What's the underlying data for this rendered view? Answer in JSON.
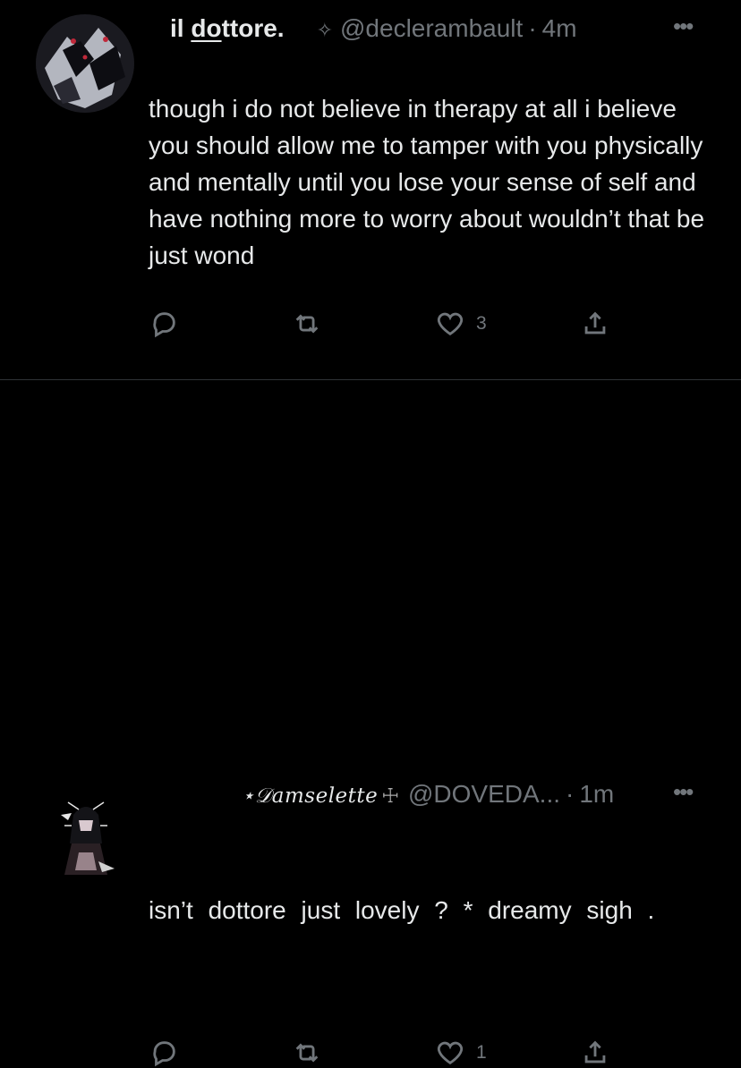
{
  "tweets": [
    {
      "name_pre": "il ",
      "name_underlined": "do",
      "name_post": "ttore.",
      "name_suffix_icon": "✧",
      "handle": "@declerambault",
      "separator": "·",
      "time": "4m",
      "more": "•••",
      "text": "though i do not believe in therapy at all i believe you should allow me to tamper with you physically and mentally until you lose your sense of self and have nothing more to worry about wouldn’t that be just wond",
      "actions": {
        "reply_count": "",
        "retweet_count": "",
        "like_count": "3",
        "share": ""
      }
    },
    {
      "name": "⋆𝒟amselette",
      "name_suffix_icon": "☩",
      "handle": "@DOVEDA...",
      "separator": "·",
      "time": "1m",
      "more": "•••",
      "text": "isn’t dottore just lovely ? * dreamy sigh .",
      "actions": {
        "reply_count": "",
        "retweet_count": "",
        "like_count": "1",
        "share": ""
      }
    }
  ],
  "icons": {
    "reply": "reply-icon",
    "retweet": "retweet-icon",
    "like": "heart-icon",
    "share": "share-icon",
    "more": "more-icon"
  },
  "colors": {
    "background": "#000000",
    "text": "#e7e9ea",
    "muted": "#71767b",
    "divider": "#2f3336"
  }
}
